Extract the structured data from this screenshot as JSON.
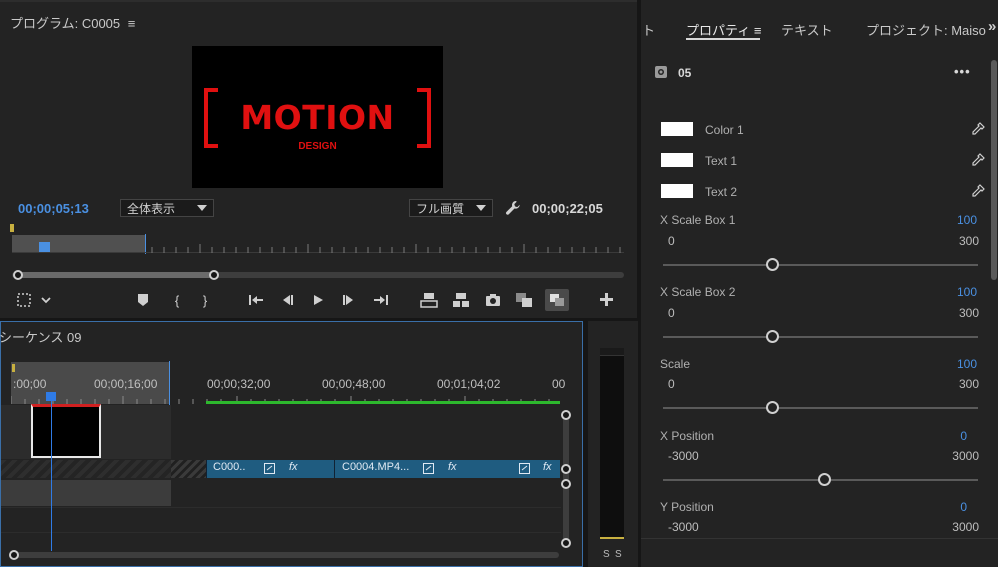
{
  "program": {
    "title": "プログラム: C0005",
    "menu_icon": "≡",
    "timecode_current": "00;00;05;13",
    "zoom_label": "全体表示",
    "quality_label": "フル画質",
    "timecode_duration": "00;00;22;05",
    "preview": {
      "headline": "MOTION",
      "subline": "DESIGN",
      "accent": "#e01010"
    }
  },
  "timeline": {
    "title": "シーケンス 09",
    "ruler": [
      ":00;00",
      "00;00;16;00",
      "00;00;32;00",
      "00;00;48;00",
      "00;01;04;02",
      "00"
    ],
    "clips": [
      {
        "label": "C000.."
      },
      {
        "label": "C0004.MP4..."
      }
    ],
    "fx_label": "fx"
  },
  "meters": {
    "labels": [
      "S",
      "S"
    ]
  },
  "properties": {
    "tabs": [
      {
        "label": "ト"
      },
      {
        "label": "プロパティ ≡"
      },
      {
        "label": "テキスト"
      },
      {
        "label": "プロジェクト: Maisor"
      }
    ],
    "overflow": "»",
    "layer_name": "05",
    "more_icon": "•••",
    "colors": [
      {
        "label": "Color 1"
      },
      {
        "label": "Text 1"
      },
      {
        "label": "Text 2"
      }
    ],
    "sliders": [
      {
        "label": "X Scale Box 1",
        "value": "100",
        "min": "0",
        "max": "300",
        "fraction": 0.333
      },
      {
        "label": "X Scale Box 2",
        "value": "100",
        "min": "0",
        "max": "300",
        "fraction": 0.333
      },
      {
        "label": "Scale",
        "value": "100",
        "min": "0",
        "max": "300",
        "fraction": 0.333
      },
      {
        "label": "X Position",
        "value": "0",
        "min": "-3000",
        "max": "3000",
        "fraction": 0.5
      },
      {
        "label": "Y Position",
        "value": "0",
        "min": "-3000",
        "max": "3000",
        "fraction": 0.5
      }
    ]
  },
  "colors": {
    "accent_blue": "#4a90e2",
    "clip_blue": "#1f5c80",
    "green_bar": "#2db82d",
    "playhead": "#2f7be6",
    "brand_red": "#e01010"
  }
}
